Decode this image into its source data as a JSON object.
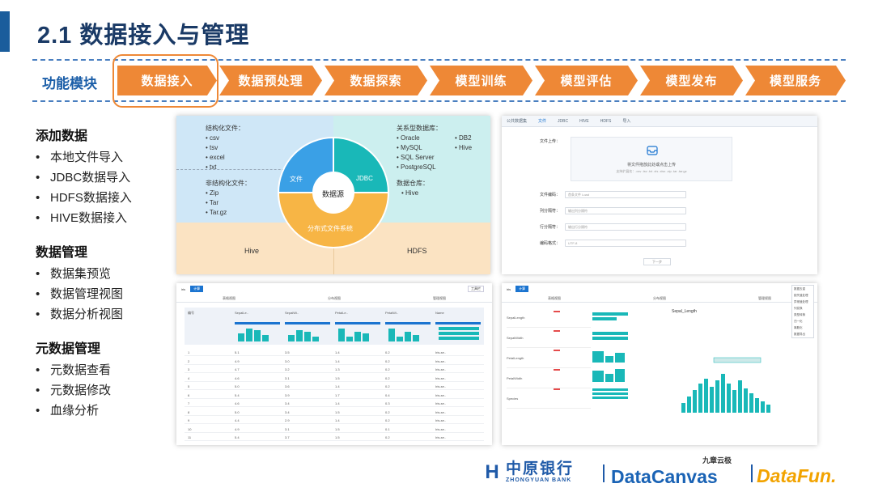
{
  "title": "2.1 数据接入与管理",
  "module_strip": {
    "label": "功能模块",
    "steps": [
      "数据接入",
      "数据预处理",
      "数据探索",
      "模型训练",
      "模型评估",
      "模型发布",
      "模型服务"
    ],
    "active_index": 0,
    "colors": {
      "step": "#ee8836",
      "label": "#1b5ea8",
      "dash": "#4a7fc0"
    }
  },
  "features": [
    {
      "title": "添加数据",
      "items": [
        "本地文件导入",
        "JDBC数据导入",
        "HDFS数据接入",
        "HIVE数据接入"
      ]
    },
    {
      "title": "数据管理",
      "items": [
        "数据集预览",
        "数据管理视图",
        "数据分析视图"
      ]
    },
    {
      "title": "元数据管理",
      "items": [
        "元数据查看",
        "元数据修改",
        "血缘分析"
      ]
    }
  ],
  "diagram": {
    "structured_title": "结构化文件：",
    "structured_items": [
      "csv",
      "tsv",
      "excel",
      "txt"
    ],
    "unstructured_title": "非结构化文件：",
    "unstructured_items": [
      "Zip",
      "Tar",
      "Tar.gz"
    ],
    "relational_title": "关系型数据库：",
    "relational_items_a": [
      "Oracle",
      "MySQL",
      "SQL Server",
      "PostgreSQL"
    ],
    "relational_items_b": [
      "DB2",
      "Hive"
    ],
    "warehouse_title": "数据仓库：",
    "warehouse_items": [
      "Hive"
    ],
    "center": "数据源",
    "seg_file": "文件",
    "seg_jdbc": "JDBC",
    "seg_dfs": "分布式文件系统",
    "bottom_left": "Hive",
    "bottom_right": "HDFS",
    "colors": {
      "file": "#3aa0e6",
      "jdbc": "#19b8b8",
      "dfs": "#f7b545"
    }
  },
  "upload_panel": {
    "tabs": [
      "公共数据集",
      "文件",
      "JDBC",
      "HIVE",
      "HDFS",
      "导入"
    ],
    "upload_label": "文件上传：",
    "upload_text": "将文件拖放此处或点击上传",
    "upload_sub": "支持扩展名：.csv .tsv .txt .xls .xlsx .zip .tar .tar.gz",
    "fields": [
      {
        "label": "文件编码：",
        "value": "首条文件 Load"
      },
      {
        "label": "列分隔符：",
        "value": "输出列分隔符"
      },
      {
        "label": "行分隔符：",
        "value": "输出行分隔符"
      },
      {
        "label": "编码格式：",
        "value": "UTF-8"
      }
    ],
    "next": "下一步"
  },
  "table_panel": {
    "dataset": "iris",
    "badge": "计算",
    "subtabs": [
      "表格视图",
      "分布视图",
      "管理视图"
    ],
    "tools": "工具栏",
    "columns": [
      "编号",
      "SepalLe..",
      "SepalWi..",
      "PetalLe..",
      "PetalWi..",
      "Name"
    ],
    "rows": [
      [
        "1",
        "5.1",
        "3.5",
        "1.4",
        "0.2",
        "Iris-se.."
      ],
      [
        "2",
        "4.9",
        "3.0",
        "1.4",
        "0.2",
        "Iris-se.."
      ],
      [
        "3",
        "4.7",
        "3.2",
        "1.3",
        "0.2",
        "Iris-se.."
      ],
      [
        "4",
        "4.6",
        "3.1",
        "1.5",
        "0.2",
        "Iris-se.."
      ],
      [
        "5",
        "5.0",
        "3.6",
        "1.4",
        "0.2",
        "Iris-se.."
      ],
      [
        "6",
        "5.4",
        "3.9",
        "1.7",
        "0.4",
        "Iris-se.."
      ],
      [
        "7",
        "4.6",
        "3.4",
        "1.4",
        "0.3",
        "Iris-se.."
      ],
      [
        "8",
        "5.0",
        "3.4",
        "1.5",
        "0.2",
        "Iris-se.."
      ],
      [
        "9",
        "4.4",
        "2.9",
        "1.4",
        "0.2",
        "Iris-se.."
      ],
      [
        "10",
        "4.9",
        "3.1",
        "1.5",
        "0.1",
        "Iris-se.."
      ],
      [
        "11",
        "5.4",
        "3.7",
        "1.5",
        "0.2",
        "Iris-se.."
      ]
    ]
  },
  "analysis_panel": {
    "dataset": "iris",
    "badge": "计算",
    "subtabs": [
      "表格视图",
      "分布视图",
      "管理视图"
    ],
    "features": [
      "SepalLength",
      "SepalWidth",
      "PetalLength",
      "PetalWidth",
      "Species"
    ],
    "stat_title": "Sepal_Length",
    "menu": [
      "数据去重",
      "缺失值处理",
      "异常值处理",
      "列变换",
      "类型转换",
      "归一化",
      "离散化",
      "数据导出"
    ]
  },
  "footer": {
    "bank_cn": "中原银行",
    "bank_en": "ZHONGYUAN BANK",
    "datacanvas": "DataCanvas",
    "datacanvas_cn": "九章云极",
    "datafun": "DataFun."
  }
}
